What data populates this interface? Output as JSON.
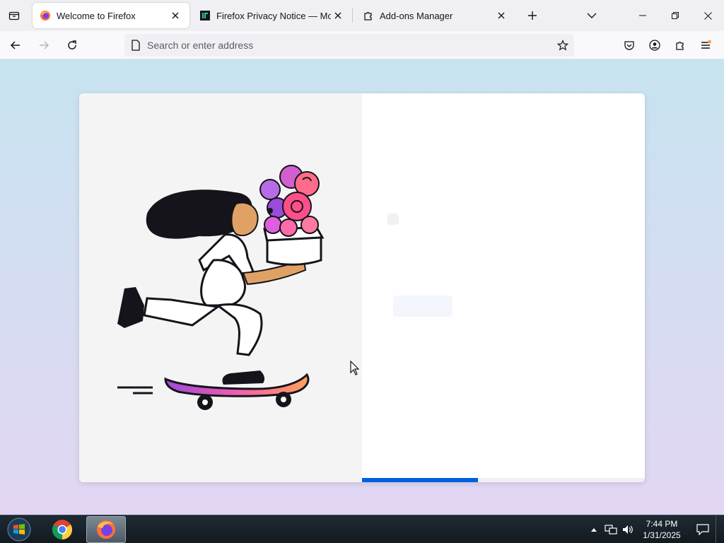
{
  "tabs": [
    {
      "title": "Welcome to Firefox",
      "icon": "firefox-icon",
      "active": true
    },
    {
      "title": "Firefox Privacy Notice — Mozilla",
      "icon": "mozilla-icon",
      "active": false
    },
    {
      "title": "Add-ons Manager",
      "icon": "puzzle-icon",
      "active": false
    }
  ],
  "navbar": {
    "url_placeholder": "Search or enter address",
    "url_value": ""
  },
  "welcome": {
    "progress_fraction": 0.41
  },
  "taskbar": {
    "apps": [
      "chrome-icon",
      "firefox-icon"
    ],
    "time": "7:44 PM",
    "date": "1/31/2025"
  },
  "colors": {
    "accent": "#0060df",
    "tabstrip": "#f0f0f4",
    "card_left": "#f4f4f5"
  }
}
